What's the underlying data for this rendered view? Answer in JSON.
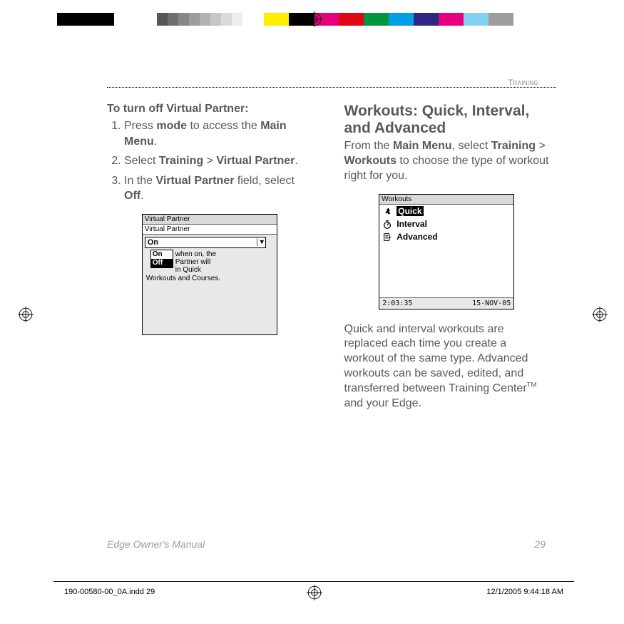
{
  "section_label": "Training",
  "left": {
    "title": "To turn off Virtual Partner:",
    "steps": [
      {
        "pre": "Press ",
        "b1": "mode",
        "mid": " to access the ",
        "b2": "Main Menu",
        "post": "."
      },
      {
        "pre": "Select ",
        "b1": "Training",
        "mid": " > ",
        "b2": "Virtual Partner",
        "post": "."
      },
      {
        "pre": "In the ",
        "b1": "Virtual Partner",
        "mid": " field, select ",
        "b2": "Off",
        "post": "."
      }
    ],
    "lcd": {
      "title": "Virtual Partner",
      "subtitle": "Virtual Partner",
      "value": "On",
      "options": [
        "On",
        "Off"
      ],
      "hint_line": "when on, the",
      "hint_line2": "Partner will",
      "hint_line3": "in Quick",
      "hint_bottom": "Workouts and Courses."
    }
  },
  "right": {
    "heading": "Workouts: Quick, Interval, and Advanced",
    "intro_pre": "From the ",
    "intro_b1": "Main Menu",
    "intro_mid": ", select ",
    "intro_b2": "Training",
    "intro_gt": " > ",
    "intro_b3": "Workouts",
    "intro_post": " to choose the type of workout right for you.",
    "lcd": {
      "title": "Workouts",
      "items": [
        "Quick",
        "Interval",
        "Advanced"
      ],
      "time": "2:03:35",
      "date": "15-NOV-05"
    },
    "para2": "Quick and interval workouts are replaced each time you create a workout of the same type. Advanced workouts can be saved, edited, and transferred between Training Center™ and your Edge."
  },
  "footer": {
    "left": "Edge Owner's Manual",
    "right": "29"
  },
  "imposition": {
    "file": "190-00580-00_0A.indd   29",
    "stamp": "12/1/2005   9:44:18 AM"
  },
  "colorbar_grays": [
    "#575756",
    "#706f6f",
    "#878787",
    "#9d9d9c",
    "#b2b2b2",
    "#c6c6c6",
    "#dadada",
    "#ededed"
  ]
}
